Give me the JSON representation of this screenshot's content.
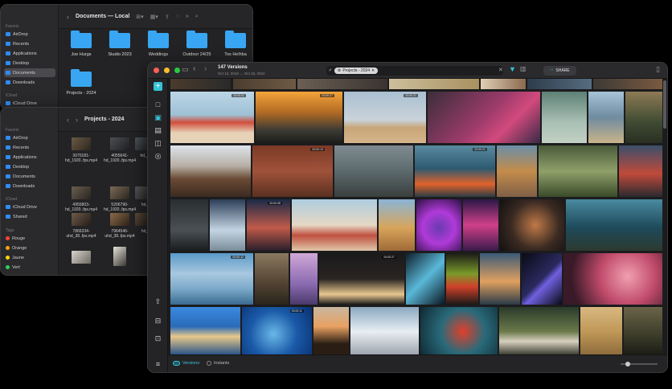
{
  "finder_top": {
    "title": "Documents — Local",
    "sidebar_sections": [
      "Favoris",
      "iCloud"
    ],
    "sidebar_items": [
      "AirDrop",
      "Recents",
      "Applications",
      "Desktop",
      "Documents",
      "Downloads",
      "iCloud Drive"
    ],
    "folders": [
      "Joe Hurgs",
      "Studio 2023",
      "Weddings",
      "Outdoor 24/25",
      "Tos Helhba",
      "Projects - 2024"
    ]
  },
  "finder_bottom": {
    "title": "Projects - 2024",
    "sidebar_sections": [
      "Favoris",
      "iCloud",
      "Tags"
    ],
    "sidebar_items": [
      "AirDrop",
      "Recents",
      "Applications",
      "Desktop",
      "Documents",
      "Downloads",
      "iCloud Drive",
      "Shared"
    ],
    "tags": [
      {
        "label": "Rouge",
        "color": "#ff453a"
      },
      {
        "label": "Orange",
        "color": "#ff9f0a"
      },
      {
        "label": "Jaune",
        "color": "#ffd60a"
      },
      {
        "label": "Vert",
        "color": "#30d158"
      }
    ],
    "videos": [
      {
        "label": "3070181-\nhd_1920..fps.mp4"
      },
      {
        "label": "4055641-\nhd_1920..fps.mp4"
      },
      {
        "label": "hd_1"
      },
      {
        "label": "4955803-\nhd_1920..fps.mp4"
      },
      {
        "label": "5206790-\nhd_1920..fps.mp4"
      },
      {
        "label": "hd_"
      },
      {
        "label": "7866334-\nuhd_38..fps.mp4"
      },
      {
        "label": "7964546-\nuhd_38..fps.mp4"
      },
      {
        "label": "hd_"
      },
      {
        "label": ""
      },
      {
        "label": ""
      }
    ]
  },
  "app": {
    "title": "147 Versions",
    "subtitle": "Oct 12, 2019 → Oct 19, 2024",
    "search_token": "Projects - 2024",
    "share_label": "SHARE",
    "accent": "#37c3d8",
    "bottom_versions": "Versions",
    "bottom_instants": "Instants",
    "badges": [
      "00:00:01",
      "00:00:27",
      "00:00:21",
      "00:00:13",
      "00:00:21",
      "00:00:08",
      "00:00:12",
      "00:00:27",
      "00:00:11"
    ]
  }
}
